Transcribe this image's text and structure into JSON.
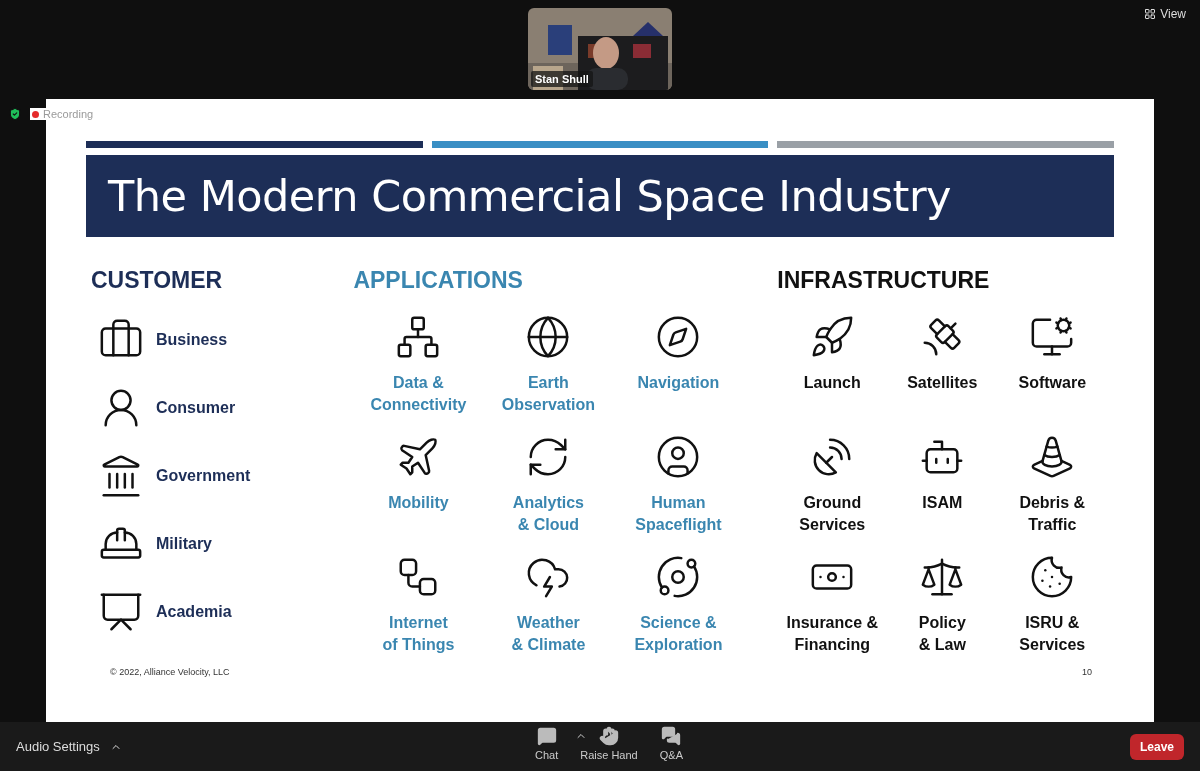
{
  "meeting": {
    "video_tile": {
      "name": "Stan Shull"
    },
    "view_button": "View",
    "recording": "Recording"
  },
  "slide": {
    "title": "The Modern Commercial Space Industry",
    "customer": {
      "heading": "CUSTOMER",
      "items": [
        "Business",
        "Consumer",
        "Government",
        "Military",
        "Academia"
      ]
    },
    "applications": {
      "heading": "APPLICATIONS",
      "items": [
        "Data &\nConnectivity",
        "Earth\nObservation",
        "Navigation",
        "Mobility",
        "Analytics\n& Cloud",
        "Human\nSpaceflight",
        "Internet\nof Things",
        "Weather\n& Climate",
        "Science &\nExploration"
      ]
    },
    "infrastructure": {
      "heading": "INFRASTRUCTURE",
      "items": [
        "Launch",
        "Satellites",
        "Software",
        "Ground\nServices",
        "ISAM",
        "Debris &\nTraffic",
        "Insurance &\nFinancing",
        "Policy\n& Law",
        "ISRU &\nServices"
      ]
    },
    "footer": "© 2022, Alliance Velocity, LLC",
    "page_number": "10"
  },
  "toolbar": {
    "audio_settings": "Audio Settings",
    "buttons": [
      {
        "label": "Chat"
      },
      {
        "label": "Raise Hand"
      },
      {
        "label": "Q&A"
      }
    ],
    "leave": "Leave"
  }
}
